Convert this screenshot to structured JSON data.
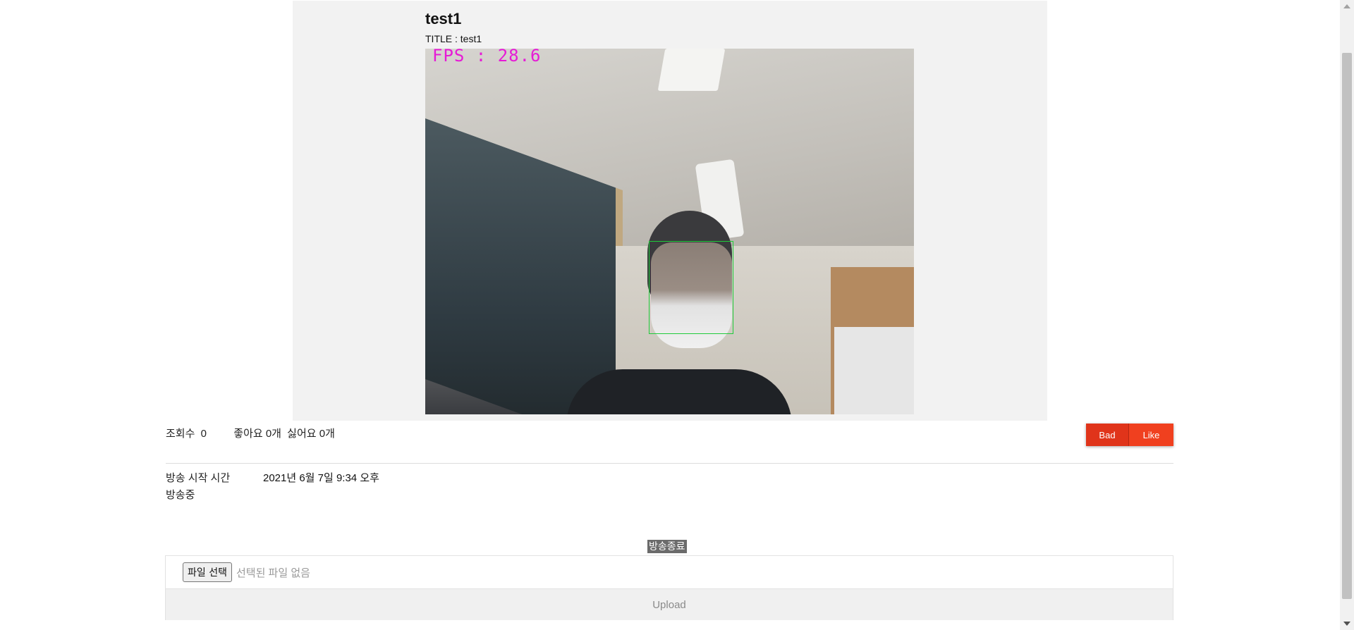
{
  "stream": {
    "name": "test1",
    "title_line": "TITLE : test1",
    "fps_overlay": "FPS : 28.6"
  },
  "stats": {
    "views_label": "조회수",
    "views_count": "0",
    "likes_text": "좋아요 0개",
    "dislikes_text": "싫어요 0개"
  },
  "reactions": {
    "bad_label": "Bad",
    "like_label": "Like"
  },
  "broadcast": {
    "start_label": "방송 시작 시간",
    "start_value": "2021년 6월 7일 9:34 오후",
    "status": "방송중",
    "end_label": "방송종료"
  },
  "upload": {
    "choose_label": "파일 선택",
    "no_file_text": "선택된 파일 없음",
    "upload_label": "Upload"
  },
  "colors": {
    "reaction_button": "#e0341a",
    "face_box": "#1fcb3a",
    "fps_text": "#e61ad6"
  }
}
